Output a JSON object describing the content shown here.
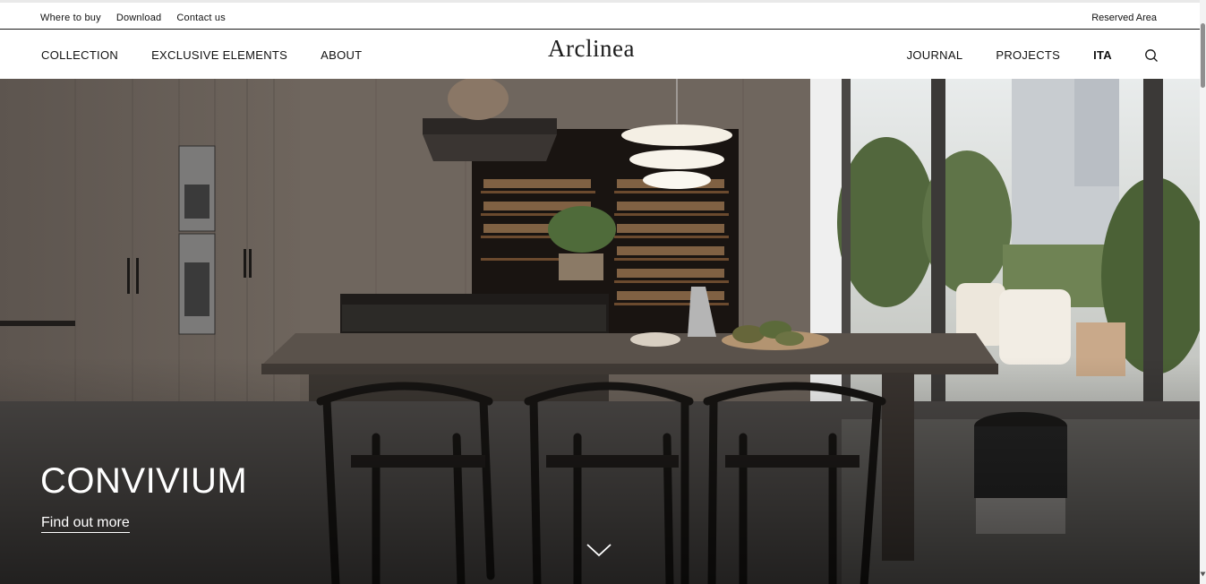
{
  "topbar": {
    "links": [
      "Where to buy",
      "Download",
      "Contact us"
    ],
    "reserved_area": "Reserved Area"
  },
  "nav": {
    "logo": "Arclinea",
    "left": [
      "COLLECTION",
      "EXCLUSIVE ELEMENTS",
      "ABOUT"
    ],
    "right": [
      "JOURNAL",
      "PROJECTS",
      "ITA"
    ],
    "search_icon": "search-icon"
  },
  "hero": {
    "title": "CONVIVIUM",
    "link": "Find out more",
    "scroll_icon": "chevron-down-icon"
  },
  "colors": {
    "text": "#111111",
    "hero_text": "#ffffff",
    "wood": "#6f655c",
    "table": "#4b433d",
    "floor": "#3a3836"
  }
}
